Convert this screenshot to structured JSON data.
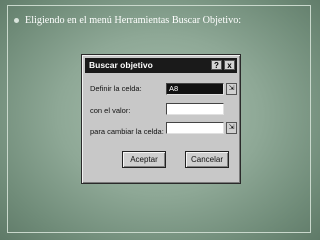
{
  "slide": {
    "bullet_text": "Eligiendo en el menú Herramientas Buscar Objetivo:"
  },
  "dialog": {
    "title": "Buscar objetivo",
    "help_glyph": "?",
    "close_glyph": "x",
    "fields": [
      {
        "label": "Definir la celda:",
        "value": "A8"
      },
      {
        "label": "con el valor:",
        "value": ""
      },
      {
        "label": "para cambiar la celda:",
        "value": ""
      }
    ],
    "ref_glyph": "⇲",
    "accept_label": "Aceptar",
    "cancel_label": "Cancelar"
  }
}
